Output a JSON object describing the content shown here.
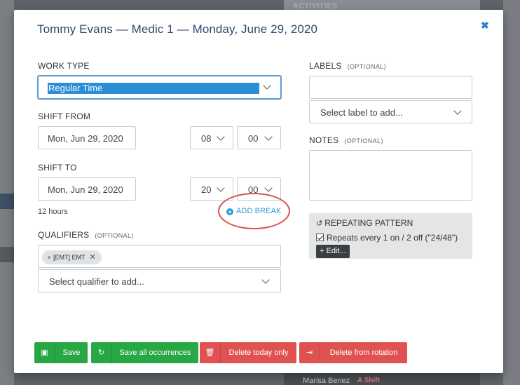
{
  "modal": {
    "title": "Tommy Evans — Medic 1 — Monday, June 29, 2020",
    "close_icon": "close-icon"
  },
  "work_type": {
    "label": "WORK TYPE",
    "value": "Regular Time"
  },
  "shift_from": {
    "label": "SHIFT FROM",
    "date": "Mon, Jun 29, 2020",
    "hour": "08",
    "minute": "00"
  },
  "shift_to": {
    "label": "SHIFT TO",
    "date": "Mon, Jun 29, 2020",
    "hour": "20",
    "minute": "00"
  },
  "duration": "12 hours",
  "add_break": "ADD BREAK",
  "qualifiers": {
    "label": "QUALIFIERS",
    "optional": "(OPTIONAL)",
    "tags": [
      "[EMT] EMT"
    ],
    "placeholder": "Select qualifier to add..."
  },
  "labels": {
    "label": "LABELS",
    "optional": "(OPTIONAL)",
    "placeholder": "Select label to add..."
  },
  "notes": {
    "label": "NOTES",
    "optional": "(OPTIONAL)"
  },
  "repeating": {
    "title": "REPEATING PATTERN",
    "description": "Repeats every 1 on / 2 off (\"24/48\")",
    "edit_label": "+ Edit..."
  },
  "footer": {
    "save": "Save",
    "save_all": "Save all occurrences",
    "delete_today": "Delete today only",
    "delete_rotation": "Delete from rotation"
  },
  "background": {
    "activities": "ACTIVITIES",
    "bottom_name": "Marisa Benez",
    "bottom_tag": "A Shift"
  },
  "colors": {
    "title": "#2c4a6e",
    "accent_blue": "#2b8ed6",
    "green": "#28a745",
    "red": "#e05252",
    "highlight_ring": "#d9534f"
  }
}
